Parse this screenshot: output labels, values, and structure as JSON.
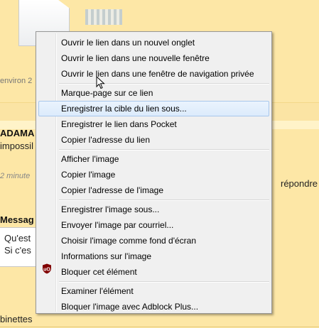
{
  "background": {
    "posted_time": "environ 2",
    "author": "ADAMA",
    "post_excerpt": "impossil",
    "reply_time": "2 minute",
    "reply_link": "répondre",
    "message_label": "Messag",
    "message_lines": [
      "Qu'est",
      "Si c'es"
    ],
    "smileys_label": "binettes"
  },
  "context_menu": {
    "items": [
      {
        "label": "Ouvrir le lien dans un nouvel onglet"
      },
      {
        "label": "Ouvrir le lien dans une nouvelle fenêtre"
      },
      {
        "label": "Ouvrir le lien dans une fenêtre de navigation privée"
      },
      {
        "label": "Marque-page sur ce lien"
      },
      {
        "label": "Enregistrer la cible du lien sous...",
        "highlighted": true
      },
      {
        "label": "Enregistrer le lien dans Pocket"
      },
      {
        "label": "Copier l'adresse du lien"
      },
      {
        "label": "Afficher l'image"
      },
      {
        "label": "Copier l'image"
      },
      {
        "label": "Copier l'adresse de l'image"
      },
      {
        "label": "Enregistrer l'image sous..."
      },
      {
        "label": "Envoyer l'image par courriel..."
      },
      {
        "label": "Choisir l'image comme fond d'écran"
      },
      {
        "label": "Informations sur l'image"
      },
      {
        "label": "Bloquer cet élément",
        "icon": "ublock-shield-icon"
      },
      {
        "label": "Examiner l'élément"
      },
      {
        "label": "Bloquer l'image avec Adblock Plus..."
      }
    ]
  },
  "colors": {
    "page_background": "#fde7a6",
    "menu_background": "#f0f0f0",
    "highlight_border": "#a8c7ec",
    "ublock_red": "#800000"
  }
}
